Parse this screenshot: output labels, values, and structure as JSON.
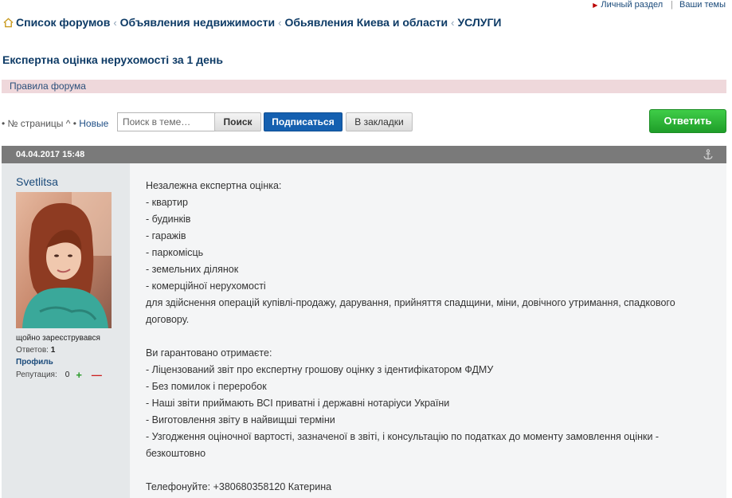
{
  "top_links": {
    "personal": "Личный раздел",
    "your_topics": "Ваши темы"
  },
  "breadcrumbs": [
    "Список форумов",
    "Объявления недвижимости",
    "Обьявления Киева и области",
    "УСЛУГИ"
  ],
  "topic_title": "Експертна оцінка нерухомості за 1 день",
  "rules_link": "Правила форума",
  "pagination": {
    "prefix": "• № страницы ^ • ",
    "new_label": "Новые"
  },
  "search": {
    "placeholder": "Поиск в теме…",
    "button": "Поиск"
  },
  "buttons": {
    "subscribe": "Подписаться",
    "bookmark": "В закладки",
    "reply": "Ответить"
  },
  "post": {
    "date": "04.04.2017 15:48",
    "author": {
      "name": "Svetlitsa",
      "status": "щойно зареєструвався",
      "replies_label": "Ответов:",
      "replies_value": "1",
      "profile": "Профиль",
      "reputation_label": "Репутация:",
      "reputation_value": "0",
      "rep_plus": "+",
      "rep_minus": "—"
    },
    "lines": [
      "Незалежна експертна оцінка:",
      "- квартир",
      "- будинків",
      "- гаражів",
      "- паркомісць",
      "- земельних ділянок",
      "- комерційної нерухомості",
      "для здійснення операцій купівлі-продажу, дарування, прийняття спадщини, міни, довічного утримання, спадкового договору.",
      "",
      "Ви гарантовано отримаєте:",
      "- Ліцензований звіт про експертну грошову оцінку з ідентифікатором ФДМУ",
      "- Без помилок і переробок",
      "- Наші звіти приймають ВСІ приватні і державні нотаріуси України",
      "- Виготовлення звіту в найвищші терміни",
      "- Узгодження оціночної вартості, зазначеної в звіті, і консультацію по податках до моменту замовлення оцінки - безкоштовно",
      "",
      "Телефонуйте: +380680358120 Катерина"
    ]
  },
  "colors": {
    "link": "#0e3b66",
    "rules_bar": "#efd8db",
    "post_header": "#7a7a7a",
    "subscribe": "#1560b0",
    "reply": "#2bb235"
  }
}
